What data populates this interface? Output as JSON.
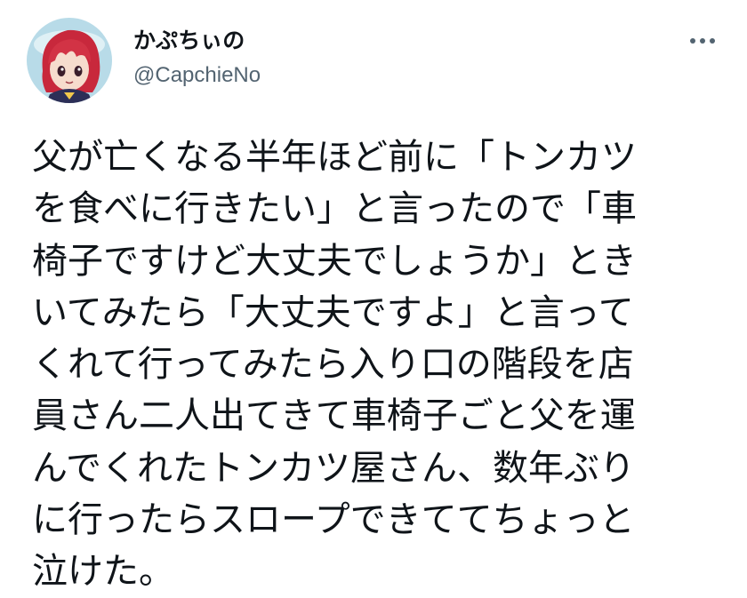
{
  "user": {
    "display_name": "かぷちぃの",
    "handle": "@CapchieNo",
    "avatar_icon": "anime-avatar-icon"
  },
  "more_icon": "more-horizontal-icon",
  "tweet": {
    "lines": [
      "父が亡くなる半年ほど前に「トンカツ",
      "を食べに行きたい」と言ったので「車",
      "椅子ですけど大丈夫でしょうか」とき",
      "いてみたら「大丈夫ですよ」と言って",
      "くれて行ってみたら入り口の階段を店",
      "員さん二人出てきて車椅子ごと父を運",
      "んでくれたトンカツ屋さん、数年ぶり",
      "に行ったらスロープできててちょっと",
      "泣けた。"
    ]
  },
  "colors": {
    "text": "#0f1419",
    "secondary": "#536471",
    "avatar_bg": "#b8dbe8"
  }
}
